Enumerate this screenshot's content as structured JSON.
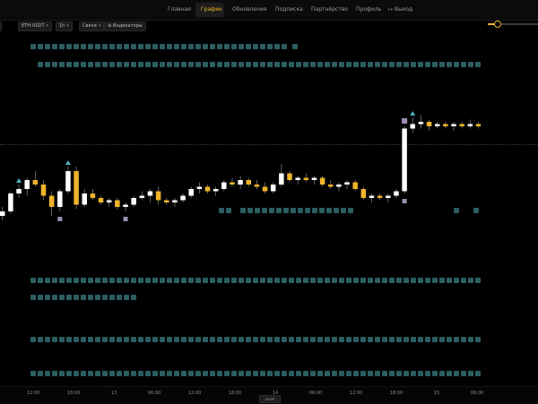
{
  "nav": {
    "items": [
      {
        "label": "Главная",
        "active": false
      },
      {
        "label": "График",
        "active": true
      },
      {
        "label": "Обновления",
        "active": false
      },
      {
        "label": "Подписка",
        "active": false
      },
      {
        "label": "Партнёрство",
        "active": false
      },
      {
        "label": "Профиль",
        "active": false
      },
      {
        "label": "Выход",
        "active": false,
        "icon": "logout-icon"
      }
    ],
    "accent_color": "#f0b429"
  },
  "zoom_slider": {
    "level": 0.2
  },
  "toolbar": {
    "pair": "ETH-USDT",
    "timeframe": "1h",
    "chart_type": "Свечи",
    "indicators": "Индикаторы"
  },
  "chart": {
    "up_color": "#ffffff",
    "down_color": "#f0b429",
    "marker_color": "#4fb3bf",
    "candles": [
      [
        2.0,
        2.4,
        1.8,
        2.2
      ],
      [
        2.2,
        3.1,
        2.1,
        3.0
      ],
      [
        3.0,
        3.4,
        2.8,
        3.2
      ],
      [
        3.2,
        3.7,
        2.9,
        3.6
      ],
      [
        3.6,
        4.0,
        3.3,
        3.4
      ],
      [
        3.4,
        3.6,
        2.7,
        2.9
      ],
      [
        2.9,
        3.1,
        2.0,
        2.4
      ],
      [
        2.4,
        3.2,
        2.2,
        3.1
      ],
      [
        3.1,
        4.2,
        3.0,
        4.0
      ],
      [
        4.0,
        4.2,
        2.3,
        2.5
      ],
      [
        2.5,
        3.2,
        2.4,
        3.0
      ],
      [
        3.0,
        3.2,
        2.7,
        2.8
      ],
      [
        2.8,
        2.9,
        2.5,
        2.6
      ],
      [
        2.6,
        2.8,
        2.4,
        2.7
      ],
      [
        2.7,
        2.8,
        2.3,
        2.4
      ],
      [
        2.4,
        2.6,
        2.2,
        2.5
      ],
      [
        2.5,
        2.9,
        2.4,
        2.8
      ],
      [
        2.8,
        3.1,
        2.7,
        2.9
      ],
      [
        2.9,
        3.2,
        2.6,
        3.1
      ],
      [
        3.1,
        3.3,
        2.5,
        2.7
      ],
      [
        2.7,
        2.8,
        2.5,
        2.6
      ],
      [
        2.6,
        2.8,
        2.4,
        2.7
      ],
      [
        2.7,
        3.0,
        2.6,
        2.9
      ],
      [
        2.9,
        3.3,
        2.8,
        3.2
      ],
      [
        3.2,
        3.5,
        3.0,
        3.3
      ],
      [
        3.3,
        3.4,
        3.0,
        3.1
      ],
      [
        3.1,
        3.3,
        2.9,
        3.2
      ],
      [
        3.2,
        3.6,
        3.1,
        3.5
      ],
      [
        3.5,
        3.7,
        3.3,
        3.4
      ],
      [
        3.4,
        3.8,
        3.2,
        3.6
      ],
      [
        3.6,
        3.7,
        3.3,
        3.4
      ],
      [
        3.4,
        3.6,
        3.2,
        3.3
      ],
      [
        3.3,
        3.5,
        3.0,
        3.1
      ],
      [
        3.1,
        3.5,
        3.0,
        3.4
      ],
      [
        3.4,
        4.3,
        3.3,
        3.9
      ],
      [
        3.9,
        4.0,
        3.5,
        3.6
      ],
      [
        3.6,
        3.8,
        3.4,
        3.7
      ],
      [
        3.7,
        3.9,
        3.5,
        3.6
      ],
      [
        3.6,
        3.8,
        3.4,
        3.7
      ],
      [
        3.7,
        3.8,
        3.3,
        3.4
      ],
      [
        3.4,
        3.6,
        3.2,
        3.3
      ],
      [
        3.3,
        3.5,
        3.1,
        3.4
      ],
      [
        3.4,
        3.6,
        3.2,
        3.5
      ],
      [
        3.5,
        3.6,
        3.1,
        3.2
      ],
      [
        3.2,
        3.3,
        2.7,
        2.8
      ],
      [
        2.8,
        3.0,
        2.6,
        2.9
      ],
      [
        2.9,
        3.0,
        2.7,
        2.8
      ],
      [
        2.8,
        3.0,
        2.6,
        2.9
      ],
      [
        2.9,
        3.2,
        2.8,
        3.1
      ],
      [
        3.1,
        6.0,
        3.0,
        5.9
      ],
      [
        5.9,
        6.4,
        5.7,
        6.1
      ],
      [
        6.1,
        6.5,
        5.9,
        6.2
      ],
      [
        6.2,
        6.3,
        5.8,
        6.0
      ],
      [
        6.0,
        6.2,
        5.9,
        6.1
      ],
      [
        6.1,
        6.2,
        5.9,
        6.0
      ],
      [
        6.0,
        6.2,
        5.8,
        6.1
      ],
      [
        6.1,
        6.2,
        5.9,
        6.0
      ],
      [
        6.0,
        6.3,
        5.9,
        6.1
      ],
      [
        6.1,
        6.2,
        5.9,
        6.0
      ]
    ],
    "y_range": [
      1.6,
      6.6
    ],
    "markers": [
      {
        "index": 2,
        "kind": "up"
      },
      {
        "index": 8,
        "kind": "up"
      },
      {
        "index": 49,
        "kind": "square"
      },
      {
        "index": 50,
        "kind": "up"
      }
    ],
    "pink_marks": [
      7,
      15,
      49
    ]
  },
  "xaxis": {
    "ticks": [
      "12:00",
      "18:00",
      "13",
      "06:00",
      "12:00",
      "18:00",
      "14",
      "06:00",
      "12:00",
      "18:00",
      "15",
      "06:00"
    ]
  },
  "scroll_control_label": "zoom"
}
